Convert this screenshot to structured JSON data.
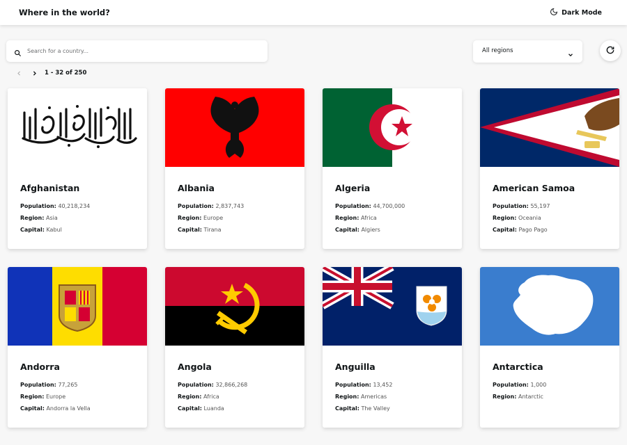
{
  "header": {
    "title": "Where in the world?",
    "theme_label": "Dark Mode",
    "theme_icon": "moon-icon"
  },
  "search": {
    "placeholder": "Search for a country...",
    "value": ""
  },
  "filter": {
    "selected": "All regions"
  },
  "pagination": {
    "range": "1 - 32 of 250"
  },
  "labels": {
    "population": "Population:",
    "region": "Region:",
    "capital": "Capital:"
  },
  "countries": [
    {
      "name": "Afghanistan",
      "population": "40,218,234",
      "region": "Asia",
      "capital": "Kabul"
    },
    {
      "name": "Albania",
      "population": "2,837,743",
      "region": "Europe",
      "capital": "Tirana"
    },
    {
      "name": "Algeria",
      "population": "44,700,000",
      "region": "Africa",
      "capital": "Algiers"
    },
    {
      "name": "American Samoa",
      "population": "55,197",
      "region": "Oceania",
      "capital": "Pago Pago"
    },
    {
      "name": "Andorra",
      "population": "77,265",
      "region": "Europe",
      "capital": "Andorra la Vella"
    },
    {
      "name": "Angola",
      "population": "32,866,268",
      "region": "Africa",
      "capital": "Luanda"
    },
    {
      "name": "Anguilla",
      "population": "13,452",
      "region": "Americas",
      "capital": "The Valley"
    },
    {
      "name": "Antarctica",
      "population": "1,000",
      "region": "Antarctic"
    }
  ],
  "colors": {
    "background": "#f7f7f7",
    "text": "#111517",
    "card": "#ffffff"
  }
}
